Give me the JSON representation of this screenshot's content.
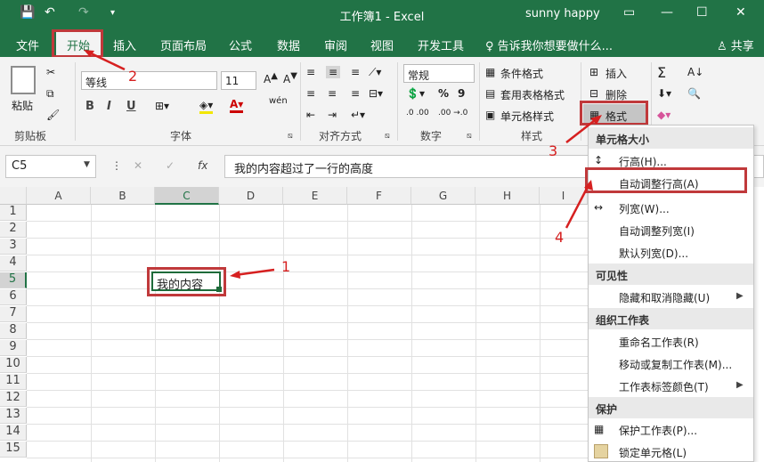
{
  "titlebar": {
    "title": "工作簿1 - Excel",
    "user": "sunny happy",
    "save_icon": "💾",
    "undo_icon": "↶",
    "redo_icon": "↷",
    "qa_more": "▾",
    "ribbon_icon": "▭",
    "min_icon": "—",
    "max_icon": "☐",
    "close_icon": "✕"
  },
  "tabs": [
    "文件",
    "开始",
    "插入",
    "页面布局",
    "公式",
    "数据",
    "审阅",
    "视图",
    "开发工具"
  ],
  "active_tab": "开始",
  "tellme": "♀ 告诉我你想要做什么...",
  "share": "♙ 共享",
  "ribbon": {
    "clipboard": {
      "paste": "粘贴",
      "label": "剪贴板"
    },
    "font": {
      "name": "等线",
      "size": "11",
      "bold": "B",
      "italic": "I",
      "underline": "U",
      "label": "字体",
      "wen": "wén"
    },
    "align": {
      "label": "对齐方式"
    },
    "number": {
      "format": "常规",
      "percent": "%",
      "comma": "9",
      "label": "数字",
      "inc": ".0 .00",
      "dec": ".00 →.0"
    },
    "styles": {
      "cond": "条件格式",
      "table": "套用表格格式",
      "cell": "单元格样式",
      "label": "样式"
    },
    "cells": {
      "insert": "插入",
      "delete": "删除",
      "format": "格式"
    },
    "editing": {
      "sum": "Σ",
      "sort": "A↓",
      "find": "🔍"
    }
  },
  "formula_bar": {
    "name_box": "C5",
    "fx": "fx",
    "cancel": "✕",
    "enter": "✓",
    "content": "我的内容超过了一行的高度"
  },
  "columns": [
    "A",
    "B",
    "C",
    "D",
    "E",
    "F",
    "G",
    "H",
    "I"
  ],
  "rows": [
    "1",
    "2",
    "3",
    "4",
    "5",
    "6",
    "7",
    "8",
    "9",
    "10",
    "11",
    "12",
    "13",
    "14",
    "15"
  ],
  "cell_c5": "我的内容",
  "menu": {
    "h1": "单元格大小",
    "row_height": "行高(H)...",
    "autofit_row": "自动调整行高(A)",
    "col_width": "列宽(W)...",
    "autofit_col": "自动调整列宽(I)",
    "default_width": "默认列宽(D)...",
    "h2": "可见性",
    "hide": "隐藏和取消隐藏(U)",
    "h3": "组织工作表",
    "rename": "重命名工作表(R)",
    "move": "移动或复制工作表(M)...",
    "tabcolor": "工作表标签颜色(T)",
    "h4": "保护",
    "protect": "保护工作表(P)...",
    "lock": "锁定单元格(L)"
  },
  "annotations": [
    "1",
    "2",
    "3",
    "4"
  ],
  "colors": {
    "excel_green": "#217346",
    "annotation_red": "#d62020"
  }
}
